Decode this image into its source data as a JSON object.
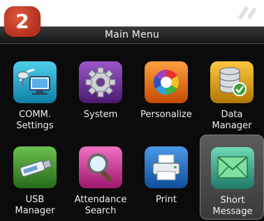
{
  "badge": "2",
  "title": "Main Menu",
  "watermark_icon": "watermark-logo-icon",
  "colors": {
    "badge": "#c43c24",
    "selected_tile": "#4a4a4a",
    "background": "#0b0b0b"
  },
  "menu_items": [
    {
      "label": "COMM.\nSettings",
      "icon": "satellite-computer-icon",
      "color": "#19a5c8"
    },
    {
      "label": "System",
      "icon": "gear-icon",
      "color": "#6a2a96"
    },
    {
      "label": "Personalize",
      "icon": "color-wheel-icon",
      "color": "#e06a10"
    },
    {
      "label": "Data\nManager",
      "icon": "database-check-icon",
      "color": "#d89a10"
    },
    {
      "label": "USB\nManager",
      "icon": "usb-drive-icon",
      "color": "#3c8a2a"
    },
    {
      "label": "Attendance\nSearch",
      "icon": "magnifier-icon",
      "color": "#d23a9a"
    },
    {
      "label": "Print",
      "icon": "printer-icon",
      "color": "#1e6fc8"
    },
    {
      "label": "Short\nMessage",
      "icon": "envelope-icon",
      "color": "#3aa890",
      "selected": true
    }
  ]
}
